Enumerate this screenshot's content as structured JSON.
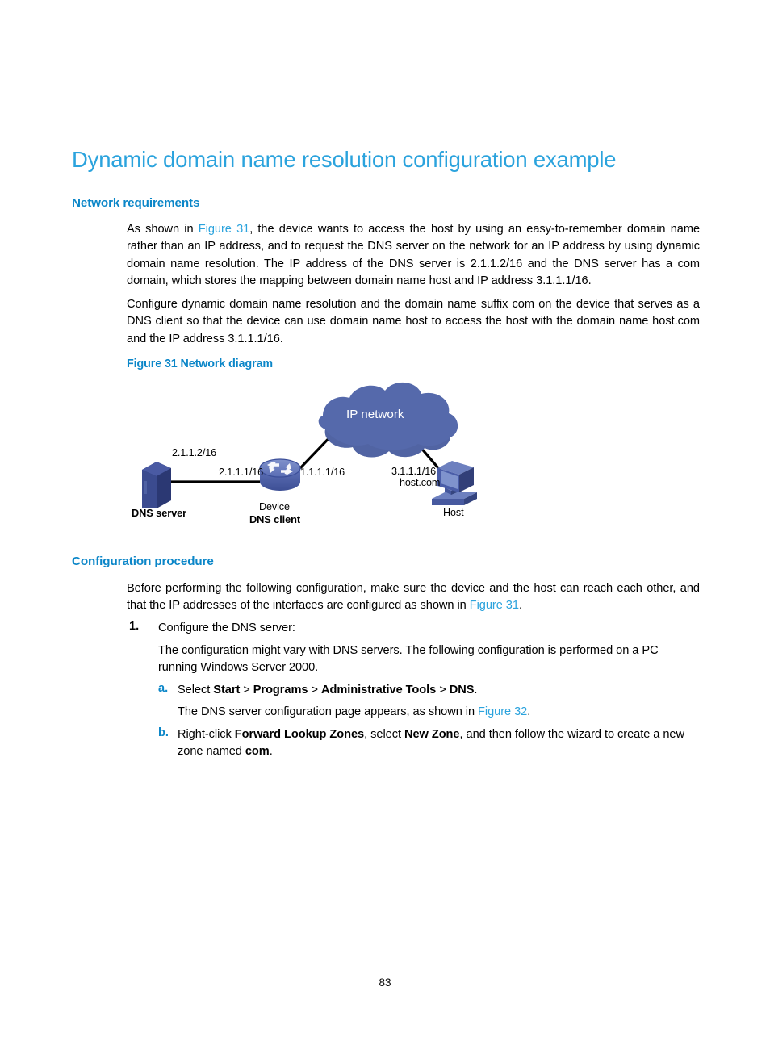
{
  "document": {
    "page_number": "83",
    "accent_color": "#0b86c8",
    "title_color": "#2ba3dd",
    "link_color": "#2ba3dd"
  },
  "title": "Dynamic domain name resolution configuration example",
  "sections": {
    "network_requirements": {
      "heading": "Network requirements",
      "para1_part1": "As shown in ",
      "para1_xref": "Figure 31",
      "para1_part2": ", the device wants to access the host by using an easy-to-remember domain name rather than an IP address, and to request the DNS server on the network for an IP address by using dynamic domain name resolution. The IP address of the DNS server is 2.1.1.2/16 and the DNS server has a com domain, which stores the mapping between domain name host and IP address 3.1.1.1/16.",
      "para2": "Configure dynamic domain name resolution and the domain name suffix com on the device that serves as a DNS client so that the device can use domain name host to access the host with the domain name host.com and the IP address 3.1.1.1/16."
    },
    "figure": {
      "caption": "Figure 31 Network diagram",
      "diagram": {
        "cloud_label": "IP network",
        "nodes": [
          {
            "name": "DNS server",
            "label": "DNS server",
            "bold": true
          },
          {
            "name": "Device",
            "label": "Device",
            "sublabel": "DNS client"
          },
          {
            "name": "Host",
            "label": "Host"
          }
        ],
        "link_labels": [
          "2.1.1.2/16",
          "2.1.1.1/16",
          "1.1.1.1/16",
          "3.1.1.1/16",
          "host.com"
        ],
        "colors": {
          "cloud": "#5569ab",
          "cloud_shade": "#4b5d99",
          "server_front": "#2f3d7e",
          "server_side": "#3f4f96",
          "server_top": "#4a5aa3",
          "router_top": "#6f82c0",
          "router_body": "#4a5da8",
          "host_body": "#4a5da8",
          "host_screen": "#6d80bf",
          "line": "#000000"
        }
      }
    },
    "configuration_procedure": {
      "heading": "Configuration procedure",
      "intro_part1": "Before performing the following configuration, make sure the device and the host can reach each other, and that the IP addresses of the interfaces are configured as shown in ",
      "intro_xref": "Figure 31",
      "intro_part2": ".",
      "step1": {
        "marker": "1.",
        "text": "Configure the DNS server:",
        "body": "The configuration might vary with DNS servers. The following configuration is performed on a PC running Windows Server 2000.",
        "substeps": [
          {
            "marker": "a.",
            "prefix": "Select ",
            "bold1": "Start",
            "sep1": " > ",
            "bold2": "Programs",
            "sep2": " > ",
            "bold3": "Administrative Tools",
            "sep3": " > ",
            "bold4": "DNS",
            "suffix": ".",
            "note_part1": "The DNS server configuration page appears, as shown in ",
            "note_xref": "Figure 32",
            "note_part2": "."
          },
          {
            "marker": "b.",
            "prefix": "Right-click ",
            "bold1": "Forward Lookup Zones",
            "sep1": ", select ",
            "bold2": "New Zone",
            "sep2": ", and then follow the wizard to create a new zone named ",
            "bold3": "com",
            "suffix": "."
          }
        ]
      }
    }
  }
}
